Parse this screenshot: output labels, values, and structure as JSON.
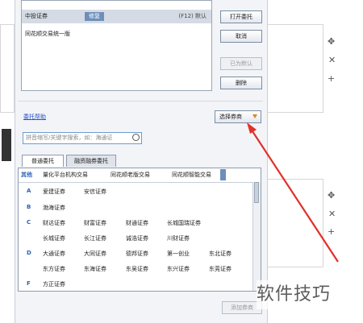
{
  "brokers": [
    {
      "name": "中投证券",
      "tag": "修复",
      "hint": "(F12) 默认"
    },
    {
      "name": "同花顺交易统一版"
    }
  ],
  "buttons": {
    "open": "打开委托",
    "cancel": "取消",
    "set_default": "已为默认",
    "delete": "删除",
    "choose_broker": "选择券商",
    "add_broker": "添加券商"
  },
  "help_link": "委托帮助",
  "search": {
    "placeholder": "拼音缩写/关键字搜索，如：海通证"
  },
  "tabs": [
    "普通委托",
    "融资融券委托"
  ],
  "categories": [
    "其他",
    "量化平台机构交易",
    "同花顺老版交易",
    "同花顺智能交易"
  ],
  "groups": [
    {
      "letter": "A",
      "rows": [
        [
          "爱建证券",
          "安信证券"
        ]
      ]
    },
    {
      "letter": "B",
      "rows": [
        [
          "渤海证券"
        ]
      ]
    },
    {
      "letter": "C",
      "rows": [
        [
          "财达证券",
          "财富证券",
          "财通证券",
          "长城国瑞证券"
        ],
        [
          "长城证券",
          "长江证券",
          "诚浩证券",
          "川财证券"
        ]
      ]
    },
    {
      "letter": "D",
      "rows": [
        [
          "大通证券",
          "大同证券",
          "德邦证券",
          "第一创业",
          "东北证券"
        ],
        [
          "东方证券",
          "东海证券",
          "东吴证券",
          "东兴证券",
          "东莞证券"
        ]
      ]
    },
    {
      "letter": "F",
      "rows": [
        [
          "方正证券"
        ]
      ]
    }
  ],
  "watermark": "软件技巧",
  "colors": {
    "accent": "#2c62b8",
    "arrow": "#e0312a",
    "selected_row": "#d5dbe4"
  },
  "icons": [
    "move-icon",
    "close-icon",
    "plus-icon",
    "search-icon",
    "dropdown-icon"
  ]
}
